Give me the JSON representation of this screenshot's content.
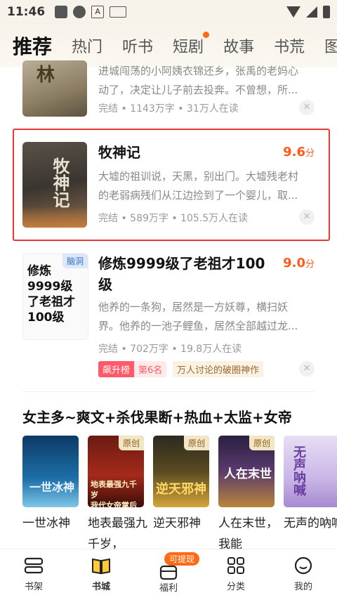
{
  "status_bar": {
    "time": "11:46"
  },
  "tabs": [
    {
      "label": "推荐",
      "active": true
    },
    {
      "label": "热门"
    },
    {
      "label": "听书"
    },
    {
      "label": "短剧",
      "dot": true
    },
    {
      "label": "故事"
    },
    {
      "label": "书荒"
    },
    {
      "label": "图书"
    }
  ],
  "books": [
    {
      "desc_lines": [
        "进城闯荡的小阿姨衣锦还乡，张禹的老妈心",
        "动了，决定让儿子前去投奔。不曾想，所..."
      ],
      "meta": "完结 • 1143万字 • 31万人在读"
    },
    {
      "title": "牧神记",
      "score": "9.6",
      "score_unit": "分",
      "desc_lines": [
        "大墟的祖训说，天黑，别出门。大墟残老村",
        "的老弱病残们从江边捡到了一个婴儿，取..."
      ],
      "meta": "完结 • 589万字 • 105.5万人在读"
    },
    {
      "title_lines": [
        "修炼9999级了老祖才100",
        "级"
      ],
      "score": "9.0",
      "score_unit": "分",
      "cover_badge": "脑洞",
      "cover_text": "修炼9999级了老祖才100级",
      "desc_lines": [
        "他养的一条狗，居然是一方妖尊，横扫妖",
        "界。他养的一池子鲤鱼，居然全部越过龙..."
      ],
      "meta": "完结 • 702万字 • 19.8万人在读",
      "rank_tag": "飙升榜",
      "rank_pos": "第6名",
      "extra_tag": "万人讨论的破圈神作"
    }
  ],
  "section": {
    "title": "女主多~爽文+杀伐果断+热血+太监+女帝",
    "cards": [
      {
        "title": "一世冰神",
        "badge": ""
      },
      {
        "title": "地表最强九千岁，",
        "badge": "原创"
      },
      {
        "title": "逆天邪神",
        "badge": "原创"
      },
      {
        "title": "人在末世，我能",
        "badge": "原创"
      },
      {
        "title": "无声的吶喊",
        "badge": ""
      }
    ]
  },
  "bottom_nav": [
    {
      "label": "书架",
      "icon": "bookshelf-icon"
    },
    {
      "label": "书城",
      "icon": "bookstore-icon",
      "active": true
    },
    {
      "label": "福利",
      "icon": "gift-icon",
      "badge": "可提现"
    },
    {
      "label": "分类",
      "icon": "category-icon"
    },
    {
      "label": "我的",
      "icon": "profile-icon"
    }
  ],
  "colors": {
    "accent": "#ff5a1a",
    "highlight_border": "#e53935",
    "tab_underline": "#ffd54a"
  }
}
